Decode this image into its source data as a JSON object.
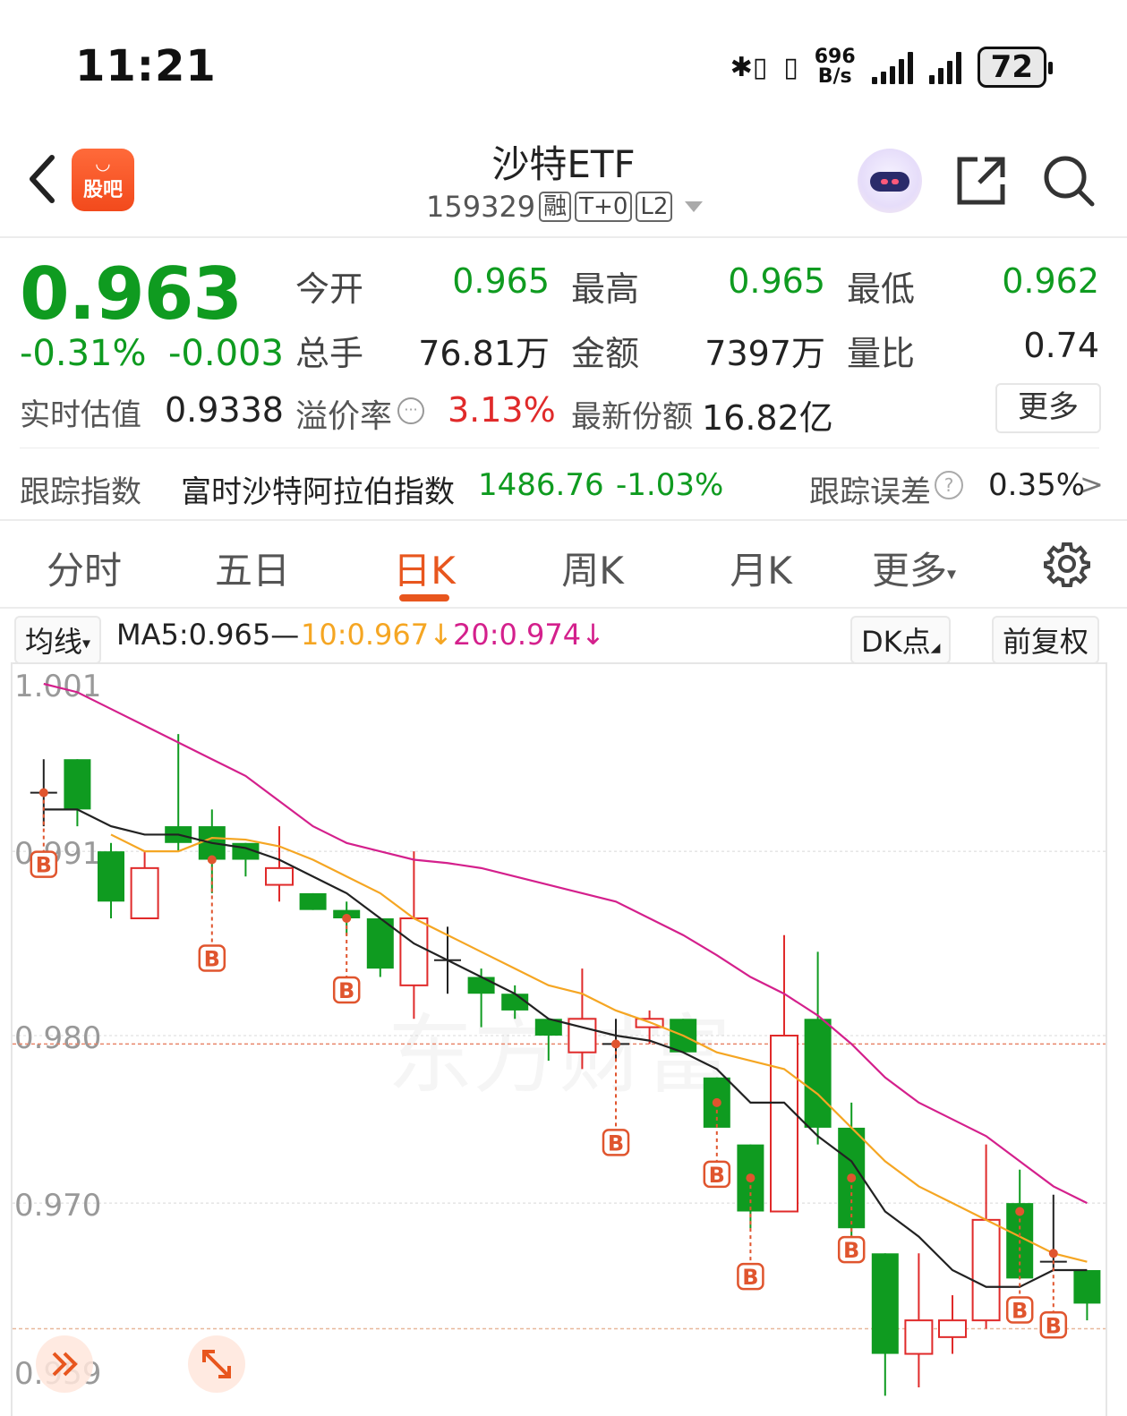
{
  "status_bar": {
    "time": "11:21",
    "netspeed_value": "696",
    "netspeed_unit": "B/s",
    "battery": "72"
  },
  "header": {
    "logo_text": "股吧",
    "title": "沙特ETF",
    "code": "159329",
    "tags": [
      "融",
      "T+0",
      "L2"
    ]
  },
  "quote": {
    "price": "0.963",
    "change_pct": "-0.31%",
    "change_abs": "-0.003",
    "fields": [
      {
        "label": "今开",
        "value": "0.965",
        "color": "green"
      },
      {
        "label": "最高",
        "value": "0.965",
        "color": "green"
      },
      {
        "label": "最低",
        "value": "0.962",
        "color": "green"
      },
      {
        "label": "总手",
        "value": "76.81万",
        "color": "black"
      },
      {
        "label": "金额",
        "value": "7397万",
        "color": "black"
      },
      {
        "label": "量比",
        "value": "0.74",
        "color": "black"
      }
    ],
    "estimate_label": "实时估值",
    "estimate_value": "0.9338",
    "premium_label": "溢价率",
    "premium_value": "3.13%",
    "shares_label": "最新份额",
    "shares_value": "16.82亿",
    "more_label": "更多"
  },
  "tracking": {
    "label": "跟踪指数",
    "index_name": "富时沙特阿拉伯指数",
    "index_value": "1486.76",
    "index_change": "-1.03%",
    "error_label": "跟踪误差",
    "error_value": "0.35%",
    "arrow": ">"
  },
  "tabs": [
    {
      "label": "分时",
      "active": false
    },
    {
      "label": "五日",
      "active": false
    },
    {
      "label": "日K",
      "active": true
    },
    {
      "label": "周K",
      "active": false
    },
    {
      "label": "月K",
      "active": false
    },
    {
      "label": "更多",
      "active": false
    }
  ],
  "ma_bar": {
    "selector": "均线",
    "ma5": "MA5:0.965",
    "ma10": "10:0.967",
    "ma20": "20:0.974",
    "dk_label": "DK点",
    "adjust_label": "前复权",
    "colors": {
      "ma5": "#222222",
      "ma10": "#f5a623",
      "ma20": "#d4208c"
    }
  },
  "chart_data": {
    "type": "candlestick",
    "y_ticks": [
      "1.001",
      "0.991",
      "0.980",
      "0.970",
      "0.959"
    ],
    "ylim": [
      0.959,
      1.001
    ],
    "current_price_line": 0.9795,
    "colors": {
      "up": "#e02a2a",
      "down": "#0f9b20",
      "neutral": "#222222"
    },
    "candles": [
      {
        "o": 0.9945,
        "h": 0.9965,
        "l": 0.9925,
        "c": 0.9945
      },
      {
        "o": 0.9965,
        "h": 0.9965,
        "l": 0.9925,
        "c": 0.9935
      },
      {
        "o": 0.991,
        "h": 0.9915,
        "l": 0.987,
        "c": 0.988
      },
      {
        "o": 0.987,
        "h": 0.991,
        "l": 0.987,
        "c": 0.99
      },
      {
        "o": 0.9925,
        "h": 0.998,
        "l": 0.991,
        "c": 0.9915
      },
      {
        "o": 0.9925,
        "h": 0.9935,
        "l": 0.9885,
        "c": 0.9905
      },
      {
        "o": 0.9915,
        "h": 0.9915,
        "l": 0.9895,
        "c": 0.9905
      },
      {
        "o": 0.989,
        "h": 0.9925,
        "l": 0.988,
        "c": 0.99
      },
      {
        "o": 0.9885,
        "h": 0.9885,
        "l": 0.9875,
        "c": 0.9875
      },
      {
        "o": 0.9875,
        "h": 0.988,
        "l": 0.986,
        "c": 0.987
      },
      {
        "o": 0.987,
        "h": 0.987,
        "l": 0.9835,
        "c": 0.984
      },
      {
        "o": 0.983,
        "h": 0.991,
        "l": 0.981,
        "c": 0.987
      },
      {
        "o": 0.9845,
        "h": 0.9865,
        "l": 0.9825,
        "c": 0.9845
      },
      {
        "o": 0.9835,
        "h": 0.984,
        "l": 0.9805,
        "c": 0.9825
      },
      {
        "o": 0.9825,
        "h": 0.983,
        "l": 0.981,
        "c": 0.9815
      },
      {
        "o": 0.981,
        "h": 0.981,
        "l": 0.9785,
        "c": 0.98
      },
      {
        "o": 0.979,
        "h": 0.984,
        "l": 0.978,
        "c": 0.981
      },
      {
        "o": 0.9795,
        "h": 0.981,
        "l": 0.9785,
        "c": 0.9795
      },
      {
        "o": 0.9805,
        "h": 0.9815,
        "l": 0.9795,
        "c": 0.981
      },
      {
        "o": 0.981,
        "h": 0.981,
        "l": 0.979,
        "c": 0.979
      },
      {
        "o": 0.9775,
        "h": 0.9775,
        "l": 0.9745,
        "c": 0.9745
      },
      {
        "o": 0.9735,
        "h": 0.9735,
        "l": 0.9685,
        "c": 0.9695
      },
      {
        "o": 0.9695,
        "h": 0.986,
        "l": 0.9695,
        "c": 0.98
      },
      {
        "o": 0.981,
        "h": 0.985,
        "l": 0.9735,
        "c": 0.9745
      },
      {
        "o": 0.9745,
        "h": 0.976,
        "l": 0.9675,
        "c": 0.9685
      },
      {
        "o": 0.967,
        "h": 0.967,
        "l": 0.9585,
        "c": 0.961
      },
      {
        "o": 0.961,
        "h": 0.967,
        "l": 0.959,
        "c": 0.963
      },
      {
        "o": 0.962,
        "h": 0.9645,
        "l": 0.961,
        "c": 0.963
      },
      {
        "o": 0.963,
        "h": 0.9735,
        "l": 0.9625,
        "c": 0.969
      },
      {
        "o": 0.97,
        "h": 0.972,
        "l": 0.9655,
        "c": 0.9655
      },
      {
        "o": 0.9665,
        "h": 0.9705,
        "l": 0.966,
        "c": 0.9665
      },
      {
        "o": 0.966,
        "h": 0.966,
        "l": 0.963,
        "c": 0.964
      }
    ],
    "ma5": [
      0.9935,
      0.9935,
      0.9925,
      0.992,
      0.992,
      0.9915,
      0.9912,
      0.9905,
      0.9895,
      0.9885,
      0.987,
      0.9855,
      0.9845,
      0.9835,
      0.9825,
      0.981,
      0.9805,
      0.98,
      0.9797,
      0.979,
      0.978,
      0.976,
      0.976,
      0.974,
      0.9725,
      0.9695,
      0.968,
      0.966,
      0.965,
      0.965,
      0.966,
      0.966
    ],
    "ma10": [
      null,
      null,
      0.992,
      0.991,
      0.991,
      0.9918,
      0.9917,
      0.9913,
      0.9905,
      0.9895,
      0.9885,
      0.987,
      0.986,
      0.985,
      0.984,
      0.983,
      0.9825,
      0.9815,
      0.9808,
      0.98,
      0.979,
      0.9785,
      0.978,
      0.9765,
      0.9745,
      0.9725,
      0.971,
      0.97,
      0.969,
      0.968,
      0.967,
      0.9665
    ],
    "ma20": [
      1.001,
      1.0005,
      0.9995,
      0.9985,
      0.9975,
      0.9965,
      0.9955,
      0.994,
      0.9925,
      0.9915,
      0.991,
      0.9905,
      0.9903,
      0.99,
      0.9895,
      0.989,
      0.9885,
      0.988,
      0.987,
      0.986,
      0.9848,
      0.9835,
      0.9825,
      0.9812,
      0.9795,
      0.9775,
      0.976,
      0.975,
      0.974,
      0.9725,
      0.971,
      0.97
    ],
    "b_signals": [
      {
        "i": 0,
        "price": 0.9945
      },
      {
        "i": 5,
        "price": 0.9905
      },
      {
        "i": 9,
        "price": 0.987
      },
      {
        "i": 17,
        "price": 0.9795
      },
      {
        "i": 20,
        "price": 0.976
      },
      {
        "i": 21,
        "price": 0.9715
      },
      {
        "i": 24,
        "price": 0.9715
      },
      {
        "i": 29,
        "price": 0.9695
      },
      {
        "i": 30,
        "price": 0.967
      }
    ],
    "watermark": "东方财富"
  }
}
